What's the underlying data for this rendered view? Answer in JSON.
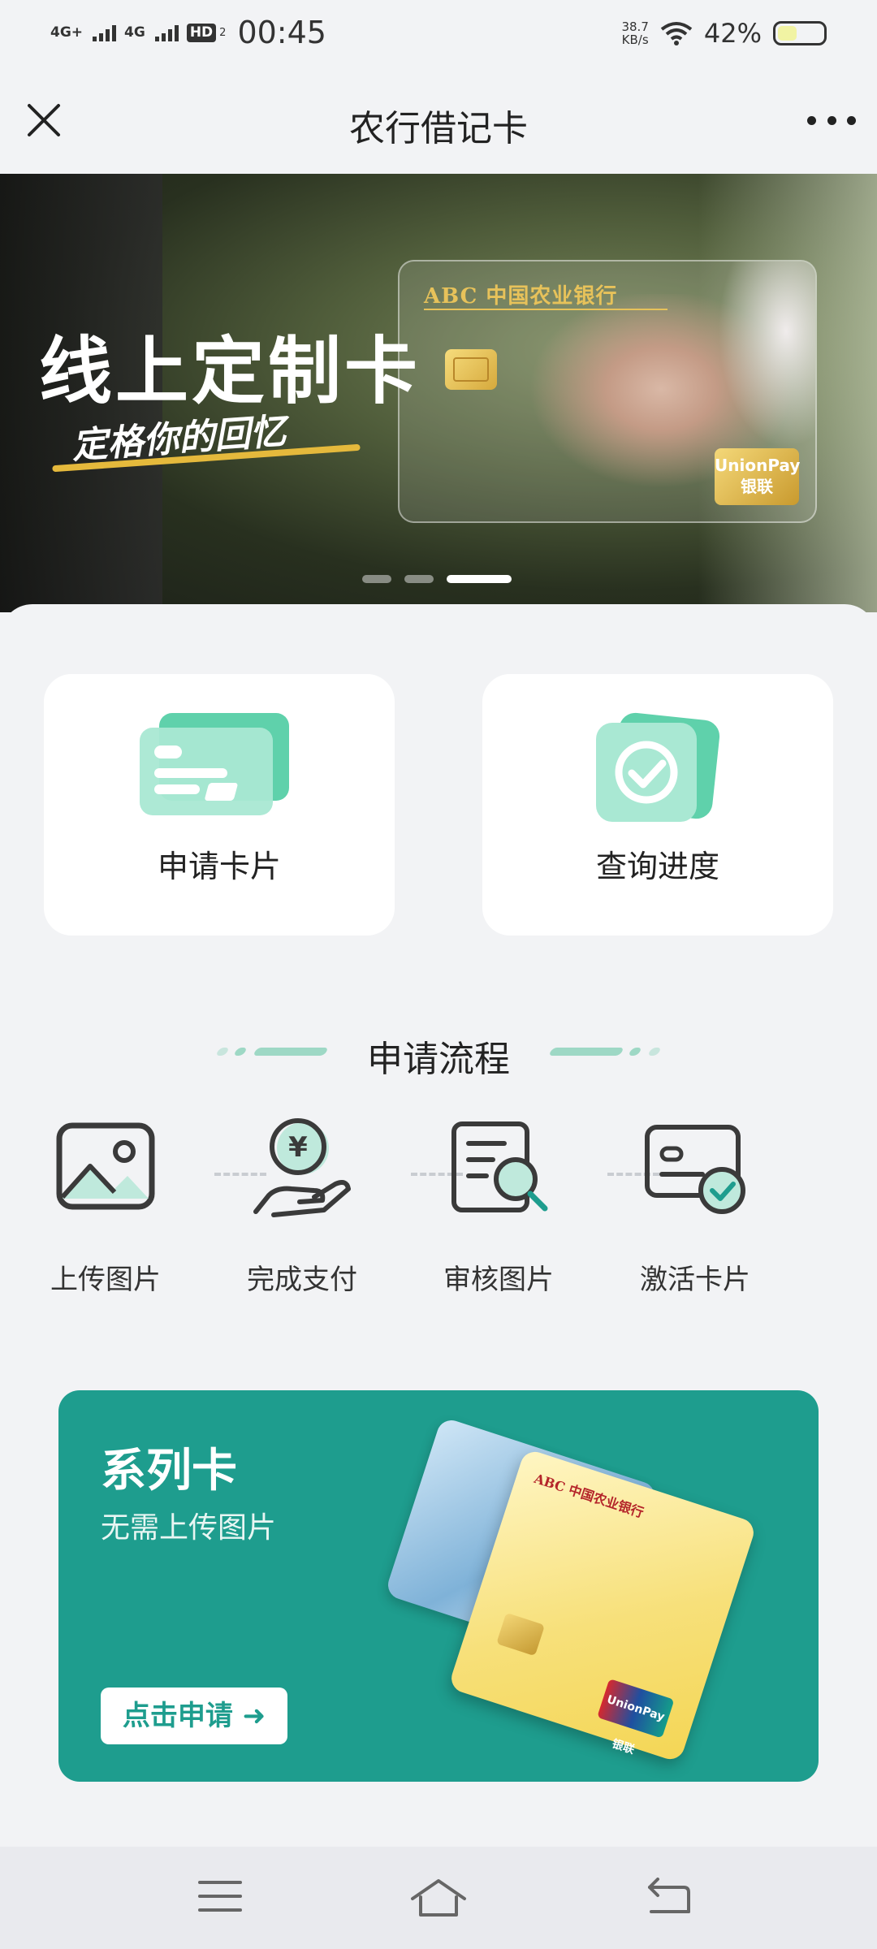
{
  "status_bar": {
    "network_1": "4G+",
    "network_2": "4G",
    "hd": "HD",
    "hd_sub": "2",
    "time": "00:45",
    "speed_value": "38.7",
    "speed_unit": "KB/s",
    "battery_percent": "42%",
    "battery_level": 0.42
  },
  "navbar": {
    "title": "农行借记卡",
    "close_icon": "close-icon",
    "more_icon": "more-horizontal-icon"
  },
  "banner": {
    "title": "线上定制卡",
    "subtitle": "定格你的回忆",
    "card_bank_name": "ABC 中国农业银行",
    "card_network": "UnionPay 银联",
    "slides_total": 3,
    "active_slide": 3
  },
  "actions": [
    {
      "label": "申请卡片",
      "icon": "card-stack-icon"
    },
    {
      "label": "查询进度",
      "icon": "check-circle-card-icon"
    }
  ],
  "process": {
    "title": "申请流程",
    "steps": [
      {
        "label": "上传图片",
        "icon": "image-upload-icon"
      },
      {
        "label": "完成支付",
        "icon": "yuan-coin-hand-icon"
      },
      {
        "label": "审核图片",
        "icon": "document-search-icon"
      },
      {
        "label": "激活卡片",
        "icon": "card-check-icon"
      }
    ]
  },
  "series_card": {
    "title": "系列卡",
    "subtitle": "无需上传图片",
    "button_label": "点击申请 ➜",
    "front_card_bank": "ABC 中国农业银行",
    "front_card_network": "UnionPay 银联",
    "accent_color": "#1e9d8e"
  },
  "system_nav": {
    "menu_icon": "menu-icon",
    "home_icon": "home-icon",
    "back_icon": "back-icon"
  },
  "colors": {
    "brand_green": "#1e9d8e",
    "icon_mint": "#5fd1ab",
    "background": "#f2f3f5"
  }
}
